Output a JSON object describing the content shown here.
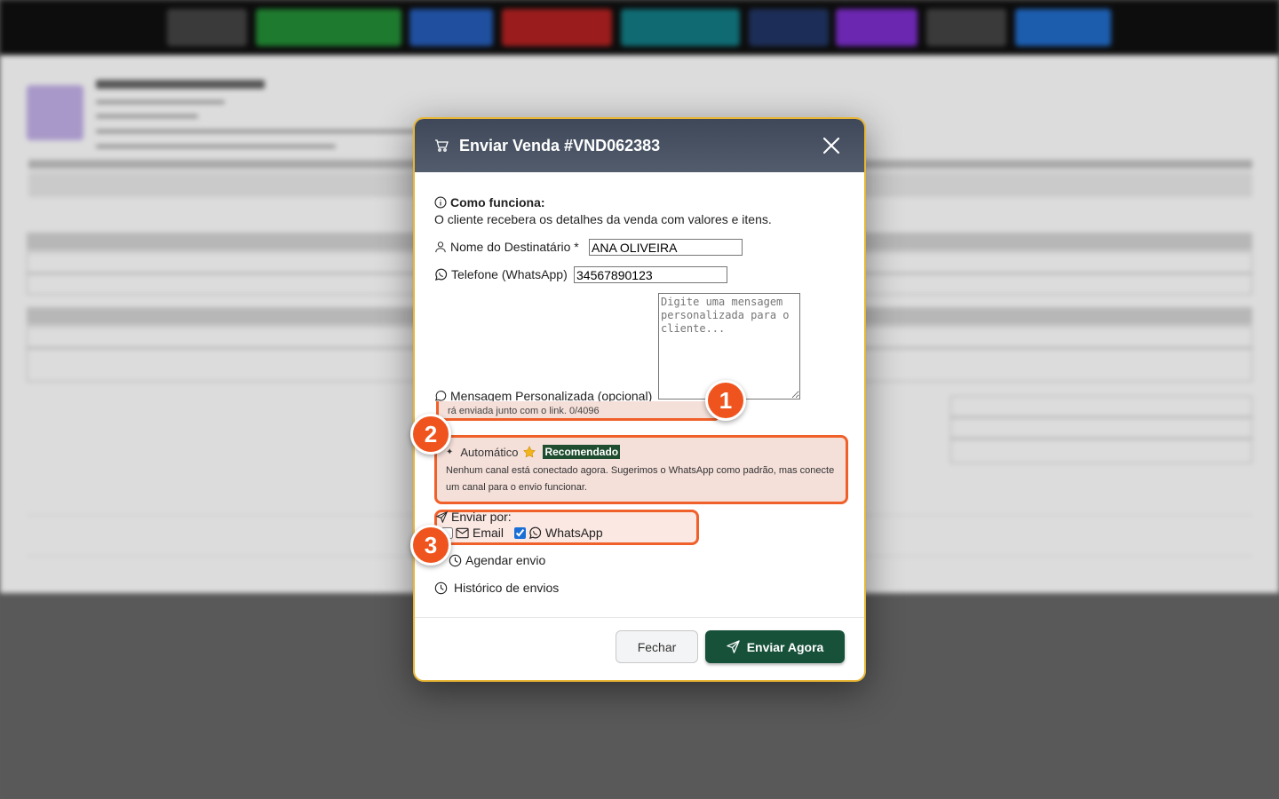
{
  "modal": {
    "title": "Enviar Venda #VND062383",
    "info_title": "Como funciona:",
    "info_text": "O cliente recebera os detalhes da venda com valores e itens.",
    "recipient_label": "Nome do Destinatário *",
    "recipient_value": "ANA OLIVEIRA",
    "phone_label": "Telefone (WhatsApp)",
    "phone_value": "34567890123",
    "message_label": "Mensagem Personalizada (opcional)",
    "message_placeholder": "Digite uma mensagem personalizada para o cliente...",
    "message_hint": "rá enviada junto com o link. 0/4096",
    "auto_label": "Automático",
    "auto_badge": "Recomendado",
    "auto_desc": "Nenhum canal está conectado agora. Sugerimos o WhatsApp como padrão, mas conecte um canal para o envio funcionar.",
    "send_via_label": "Enviar por:",
    "email_label": "Email",
    "whatsapp_label": "WhatsApp",
    "schedule_label": "Agendar envio",
    "history_label": "Histórico de envios",
    "close_button": "Fechar",
    "send_button": "Enviar Agora"
  },
  "annotations": [
    "1",
    "2",
    "3"
  ],
  "colors": {
    "header_bg": "#434d5e",
    "modal_border": "#e8b634",
    "highlight": "#f0602a",
    "send_button": "#17513a",
    "badge": "#1f4d2f"
  }
}
